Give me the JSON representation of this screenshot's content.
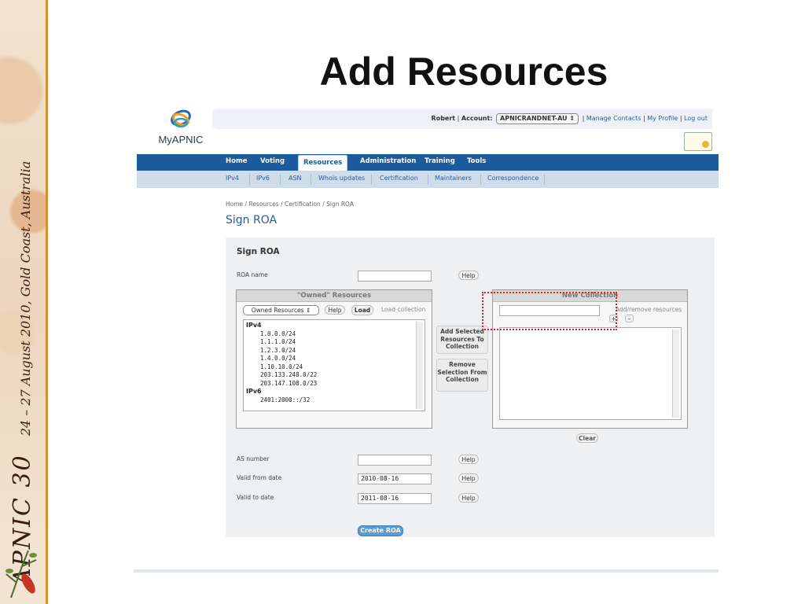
{
  "slide": {
    "title": "Add Resources",
    "banner_event": "APNIC 30",
    "banner_dates": "24 – 27 August 2010, Gold Coast, Australia"
  },
  "app": {
    "logo_text": "MyAPNIC",
    "top": {
      "user": "Robert",
      "account_label": "Account:",
      "account_value": "APNICRANDNET-AU",
      "links": [
        "Manage Contacts",
        "My Profile",
        "Log out"
      ]
    },
    "nav": [
      "Home",
      "Voting",
      "Resources",
      "Administration",
      "Training",
      "Tools"
    ],
    "nav_active": "Resources",
    "subnav": [
      "IPv4",
      "IPv6",
      "ASN",
      "Whois updates",
      "Certification",
      "Maintainers",
      "Correspondence"
    ],
    "breadcrumb": "Home / Resources / Certification / Sign ROA",
    "page_title": "Sign ROA"
  },
  "form": {
    "section_title": "Sign ROA",
    "roa_name_label": "ROA name",
    "roa_name_value": "",
    "help": "Help",
    "owned_title": "\"Owned\" Resources",
    "owned_select": "Owned Resources",
    "load": "Load",
    "load_collection": "Load collection",
    "owned": [
      {
        "group": "IPv4",
        "items": [
          "1.0.0.0/24",
          "1.1.1.0/24",
          "1.2.3.0/24",
          "1.4.0.0/24",
          "1.10.10.0/24",
          "203.133.248.0/22",
          "203.147.108.0/23"
        ]
      },
      {
        "group": "IPv6",
        "items": [
          "2401:2000::/32"
        ]
      }
    ],
    "add_selected": "Add Selected Resources To Collection",
    "remove_selection": "Remove Selection From Collection",
    "new_collection_title": "New Collection",
    "add_remove_label": "Add/remove resources",
    "plus": "+",
    "minus": "–",
    "clear": "Clear",
    "as_number_label": "AS number",
    "as_number_value": "",
    "valid_from_label": "Valid from date",
    "valid_from_value": "2010-08-16",
    "valid_to_label": "Valid to date",
    "valid_to_value": "2011-08-16",
    "create_roa": "Create ROA"
  }
}
